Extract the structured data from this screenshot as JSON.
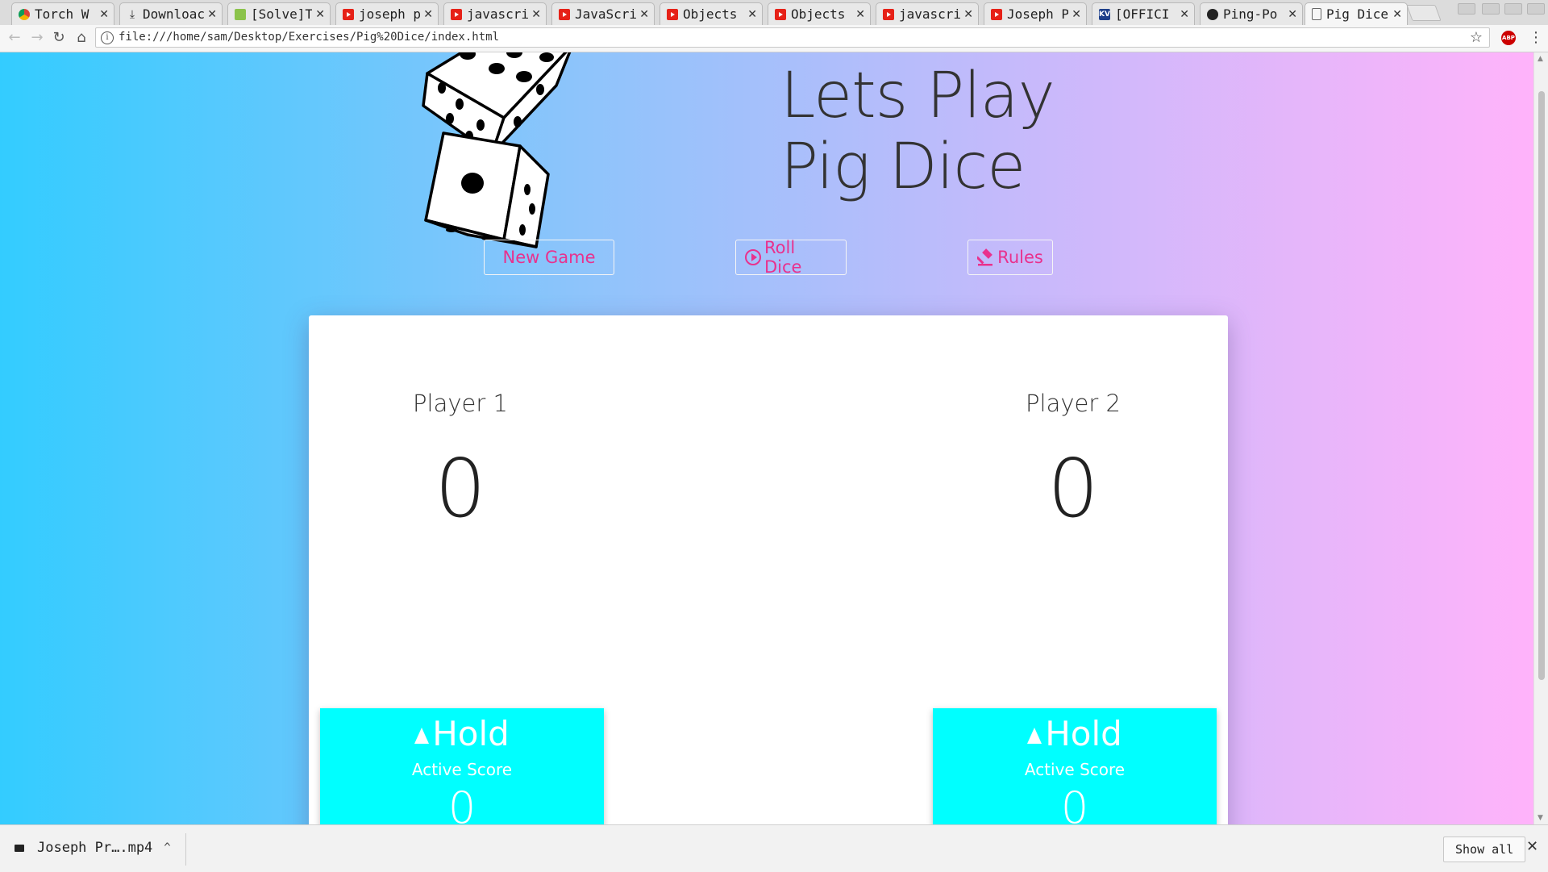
{
  "browser": {
    "tabs": [
      {
        "title": "Torch W",
        "icon": "chrome-icon"
      },
      {
        "title": "Downloac",
        "icon": "download-icon"
      },
      {
        "title": "[Solve]T",
        "icon": "solve-icon"
      },
      {
        "title": "joseph p",
        "icon": "youtube-icon"
      },
      {
        "title": "javascrip",
        "icon": "youtube-icon"
      },
      {
        "title": "JavaScri",
        "icon": "youtube-icon"
      },
      {
        "title": "Objects",
        "icon": "youtube-icon"
      },
      {
        "title": "Objects",
        "icon": "youtube-icon"
      },
      {
        "title": "javascrip",
        "icon": "youtube-icon"
      },
      {
        "title": "Joseph P",
        "icon": "youtube-icon"
      },
      {
        "title": "[OFFICI",
        "icon": "kv-icon"
      },
      {
        "title": "Ping-Po",
        "icon": "github-icon"
      },
      {
        "title": "Pig Dice",
        "icon": "document-icon",
        "active": true
      }
    ],
    "url": "file:///home/sam/Desktop/Exercises/Pig%20Dice/index.html",
    "abp_label": "ABP"
  },
  "page": {
    "heading_line1": "Lets Play",
    "heading_line2": "Pig Dice",
    "buttons": {
      "new_game": "New Game",
      "roll_dice": "Roll Dice",
      "rules": "Rules"
    },
    "players": [
      {
        "name": "Player 1",
        "score": "0",
        "hold": "Hold",
        "active_label": "Active Score",
        "active_score": "0"
      },
      {
        "name": "Player 2",
        "score": "0",
        "hold": "Hold",
        "active_label": "Active Score",
        "active_score": "0"
      }
    ],
    "colors": {
      "button_text": "#e9318d",
      "hold_panel": "#00ffff",
      "gradient_left": "#33ccff",
      "gradient_right": "#ffb3fa"
    }
  },
  "downloads": {
    "item": "Joseph Pr….mp4",
    "show_all": "Show all"
  }
}
